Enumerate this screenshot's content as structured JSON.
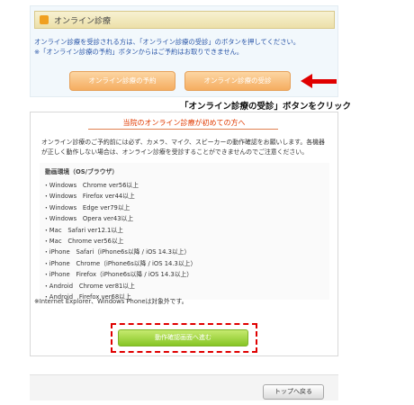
{
  "header": {
    "title": "オンライン診療",
    "icon": "clinic-icon"
  },
  "intro": {
    "line1": "オンライン診療を受診される方は、「オンライン診療の受診」のボタンを押してください。",
    "line2": "※「オンライン診療の予約」ボタンからはご予約はお取りできません。"
  },
  "buttons": {
    "reserve": "オンライン診療の予約",
    "exam": "オンライン診療の受診",
    "proceed": "動作確認画面へ進む",
    "back_to_top": "トップへ戻る"
  },
  "annotation": {
    "callout": "「オンライン診療の受診」ボタンをクリック",
    "arrow_color": "#e00000",
    "highlight_color": "#e00000"
  },
  "main": {
    "first_time_title": "当院のオンライン診療が初めての方へ",
    "confirm_line1": "オンライン診療のご予約前には必ず、カメラ、マイク、スピーカーの動作確認をお願いします。各機器",
    "confirm_line2": "が正しく動作しない場合は、オンライン診療を受診することができませんのでご注意ください。",
    "env_heading": "動画環境（OS/ブラウザ）",
    "env_items": [
      "・Windows　Chrome ver56以上",
      "・Windows　Firefox ver44以上",
      "・Windows　Edge ver79以上",
      "・Windows　Opera ver43以上",
      "・Mac　Safari ver12.1以上",
      "・Mac　Chrome ver56以上",
      "・iPhone　Safari（iPhone6s以降 / iOS 14.3以上）",
      "・iPhone　Chrome（iPhone6s以降 / iOS 14.3以上）",
      "・iPhone　Firefox（iPhone6s以降 / iOS 14.3以上）",
      "・Android　Chrome ver81以上",
      "・Android　Firefox ver68以上"
    ],
    "env_note": "※Internet Explorer、Windows Phoneは対象外です。"
  },
  "colors": {
    "orange_button": "#f5ad60",
    "green_button": "#86c525",
    "intro_text": "#2a56a8",
    "first_time_text": "#e03a00"
  }
}
